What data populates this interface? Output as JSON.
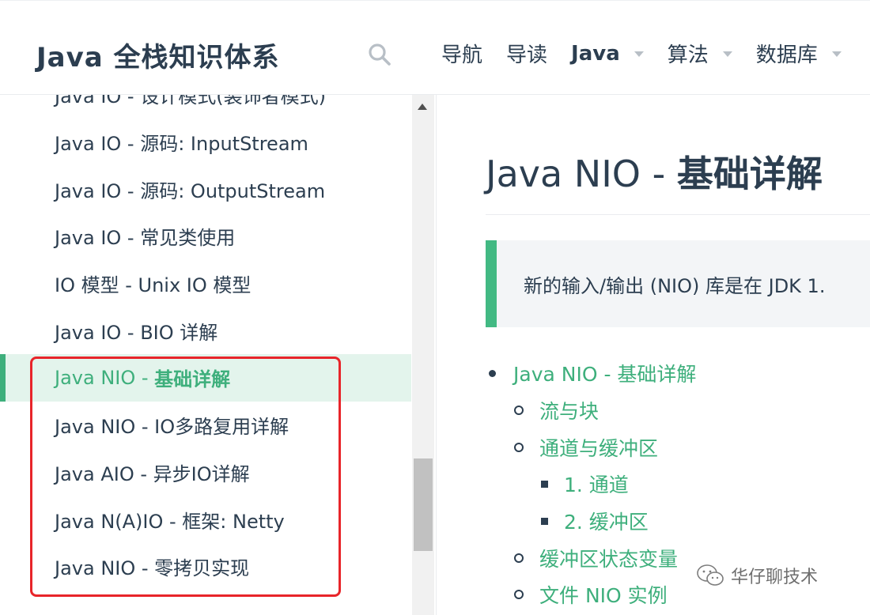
{
  "header": {
    "site_title": "Java 全栈知识体系",
    "nav": [
      {
        "label": "导航",
        "dropdown": false
      },
      {
        "label": "导读",
        "dropdown": false
      },
      {
        "label": "Java",
        "dropdown": true
      },
      {
        "label": "算法",
        "dropdown": true
      },
      {
        "label": "数据库",
        "dropdown": true
      }
    ]
  },
  "sidebar": {
    "items": [
      {
        "label": "Java IO - 设计模式(装饰者模式)"
      },
      {
        "label": "Java IO - 源码: InputStream"
      },
      {
        "label": "Java IO - 源码: OutputStream"
      },
      {
        "label": "Java IO - 常见类使用"
      },
      {
        "label": "IO 模型 - Unix IO 模型"
      },
      {
        "label": "Java IO - BIO 详解"
      },
      {
        "label_prefix": "Java NIO - ",
        "label_strong": "基础详解",
        "active": true
      },
      {
        "label": "Java NIO - IO多路复用详解"
      },
      {
        "label": "Java AIO - 异步IO详解"
      },
      {
        "label": "Java N(A)IO - 框架: Netty"
      },
      {
        "label": "Java NIO - 零拷贝实现"
      }
    ]
  },
  "content": {
    "title_prefix": "Java NIO - ",
    "title_strong": "基础详解",
    "tip_text": "新的输入/输出 (NIO) 库是在 JDK 1.",
    "toc": [
      {
        "label": "Java NIO - 基础详解"
      },
      {
        "label": "流与块"
      },
      {
        "label": "通道与缓冲区"
      },
      {
        "label": "1. 通道"
      },
      {
        "label": "2. 缓冲区"
      },
      {
        "label": "缓冲区状态变量"
      },
      {
        "label": "文件 NIO 实例"
      }
    ]
  },
  "watermark": {
    "text": "华仔聊技术"
  },
  "colors": {
    "accent": "#3eaf7c",
    "text": "#2c3e50",
    "highlight_box": "#e8252a"
  }
}
